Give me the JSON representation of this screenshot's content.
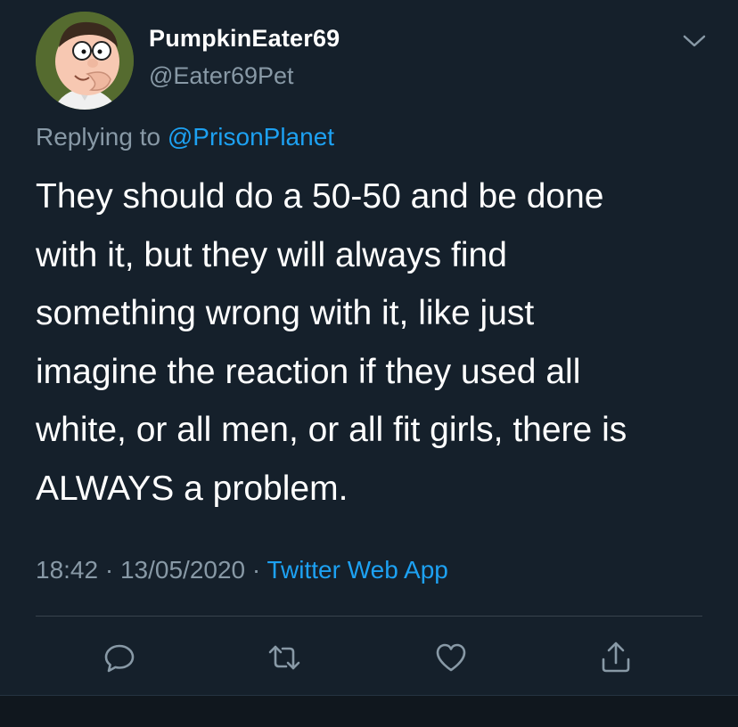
{
  "tweet": {
    "display_name": "PumpkinEater69",
    "handle": "@Eater69Pet",
    "replying_prefix": "Replying to",
    "replying_to": "@PrisonPlanet",
    "text": "They should do a 50-50 and be done\nwith it, but they will always find\nsomething wrong with it, like just\nimagine the reaction if they used all\nwhite, or all men, or all fit girls, there is\nALWAYS a problem.",
    "time": "18:42",
    "date": "13/05/2020",
    "separator": "·",
    "source": "Twitter Web App"
  },
  "actions": [
    {
      "name": "reply",
      "icon": "reply-icon"
    },
    {
      "name": "retweet",
      "icon": "retweet-icon"
    },
    {
      "name": "like",
      "icon": "heart-icon"
    },
    {
      "name": "share",
      "icon": "share-icon"
    }
  ],
  "colors": {
    "background": "#15202b",
    "text": "#ffffff",
    "secondary": "#8899a6",
    "accent": "#1da1f2",
    "divider": "#38444d"
  }
}
